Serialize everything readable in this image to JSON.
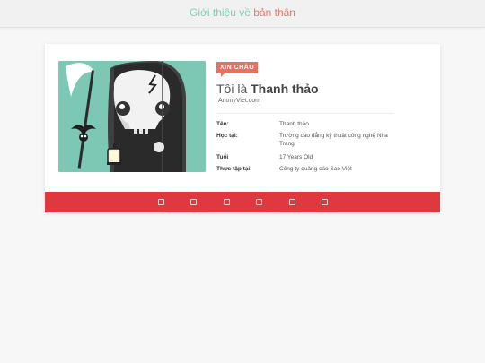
{
  "header": {
    "title_part1": "Giới thiệu về ",
    "title_part2": "bản thân",
    "accent_green": "#7fcfb0",
    "accent_red": "#e8776c"
  },
  "profile": {
    "badge": "XIN CHÀO",
    "greeting": "Tôi là ",
    "name": "Thanh thảo",
    "subtitle": "AnonyViet.com",
    "image_icon": "grim-reaper-avatar-icon",
    "fields": [
      {
        "key": "Tên:",
        "value": "Thanh thảo"
      },
      {
        "key": "Học tại:",
        "value": "Trường cao đẳng kỹ thuật công nghệ Nha Trang"
      },
      {
        "key": "Tuổi",
        "value": "17 Years Old"
      },
      {
        "key": "Thực tập tại:",
        "value": "Công ty quảng cáo Sao Việt"
      }
    ]
  },
  "footer_bar": {
    "color": "#e0383f",
    "social_icons": [
      "social-icon-1",
      "social-icon-2",
      "social-icon-3",
      "social-icon-4",
      "social-icon-5",
      "social-icon-6"
    ]
  }
}
